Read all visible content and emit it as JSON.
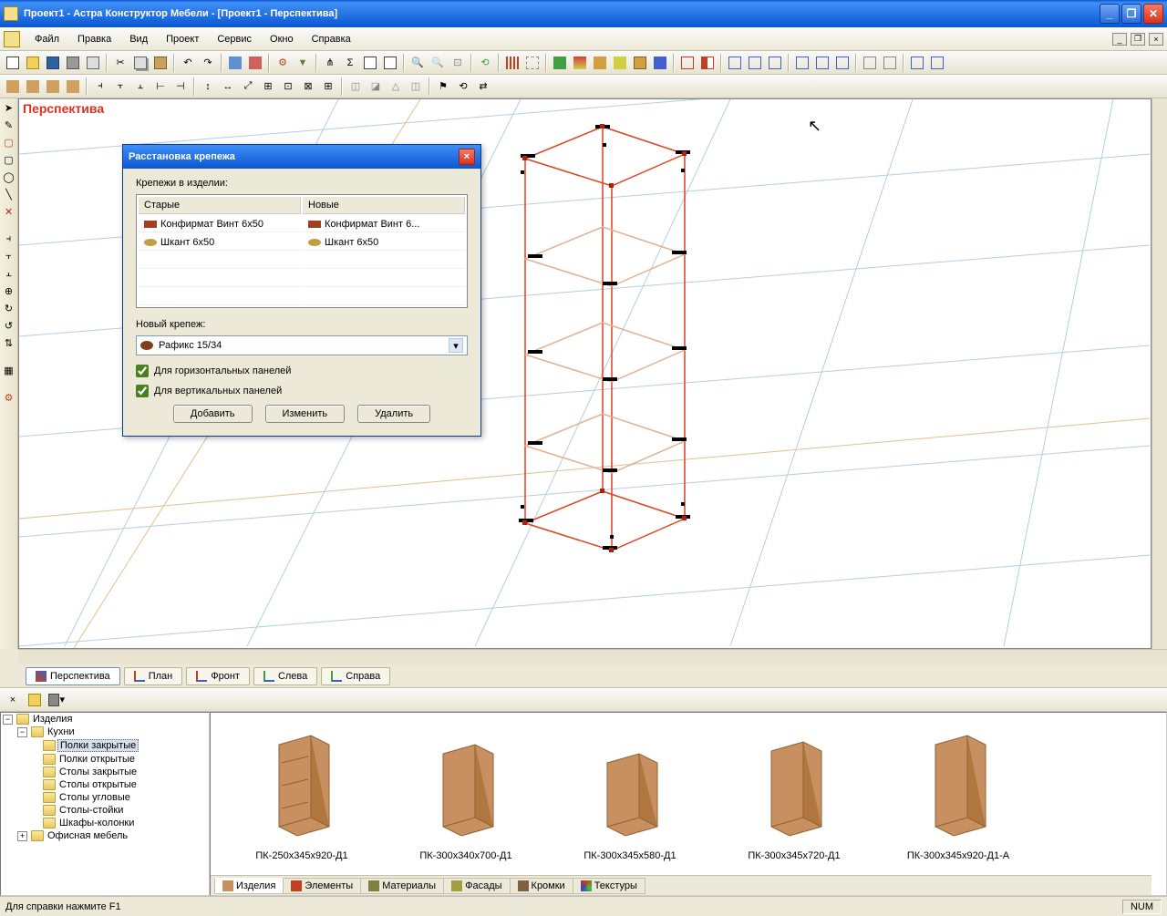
{
  "app": {
    "title": "Проект1 - Астра Конструктор Мебели - [Проект1 - Перспектива]"
  },
  "menu": {
    "file": "Файл",
    "edit": "Правка",
    "view": "Вид",
    "project": "Проект",
    "service": "Сервис",
    "window": "Окно",
    "help": "Справка"
  },
  "viewport": {
    "label": "Перспектива"
  },
  "view_tabs": {
    "perspective": "Перспектива",
    "plan": "План",
    "front": "Фронт",
    "left": "Слева",
    "right": "Справа"
  },
  "dialog": {
    "title": "Расстановка крепежа",
    "label_fasteners": "Крепежи в изделии:",
    "col_old": "Старые",
    "col_new": "Новые",
    "rows": [
      {
        "old": "Конфирмат Винт 6x50",
        "new": "Конфирмат Винт 6..."
      },
      {
        "old": "Шкант 6x50",
        "new": "Шкант 6x50"
      }
    ],
    "label_new": "Новый крепеж:",
    "select_value": "Рафикс 15/34",
    "check_horiz": "Для горизонтальных панелей",
    "check_vert": "Для вертикальных панелей",
    "btn_add": "Добавить",
    "btn_change": "Изменить",
    "btn_delete": "Удалить"
  },
  "tree": {
    "root": "Изделия",
    "kitchens": "Кухни",
    "items": [
      "Полки закрытые",
      "Полки открытые",
      "Столы закрытые",
      "Столы открытые",
      "Столы угловые",
      "Столы-стойки",
      "Шкафы-колонки"
    ],
    "office": "Офисная мебель"
  },
  "catalog": {
    "items": [
      "ПК-250х345х920-Д1",
      "ПК-300х340х700-Д1",
      "ПК-300х345х580-Д1",
      "ПК-300х345х720-Д1",
      "ПК-300х345х920-Д1-А"
    ]
  },
  "catalog_tabs": {
    "products": "Изделия",
    "elements": "Элементы",
    "materials": "Материалы",
    "facades": "Фасады",
    "edges": "Кромки",
    "textures": "Текстуры"
  },
  "status": {
    "help": "Для справки нажмите F1",
    "num": "NUM"
  }
}
